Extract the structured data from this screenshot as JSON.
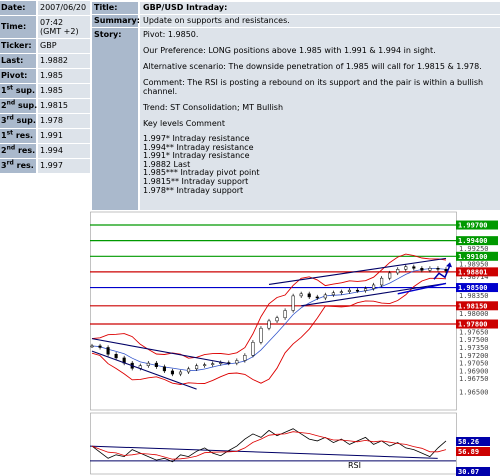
{
  "info": {
    "rows": [
      {
        "label": "Date:",
        "value": "2007/06/20"
      },
      {
        "label": "Time:",
        "value": "07:42",
        "value2": "(GMT +2)"
      },
      {
        "label": "Ticker:",
        "value": "GBP"
      },
      {
        "label": "Last:",
        "value": "1.9882"
      },
      {
        "label": "Pivot:",
        "value": "1.985"
      },
      {
        "label_num": "1",
        "label_sup": "st",
        "label_rest": " sup.",
        "value": "1.985"
      },
      {
        "label_num": "2",
        "label_sup": "nd",
        "label_rest": " sup.",
        "value": "1.9815"
      },
      {
        "label_num": "3",
        "label_sup": "rd",
        "label_rest": " sup.",
        "value": "1.978"
      },
      {
        "label_num": "1",
        "label_sup": "st",
        "label_rest": " res.",
        "value": "1.991"
      },
      {
        "label_num": "2",
        "label_sup": "nd",
        "label_rest": " res.",
        "value": "1.994"
      },
      {
        "label_num": "3",
        "label_sup": "rd",
        "label_rest": " res.",
        "value": "1.997"
      }
    ]
  },
  "story": {
    "title_label": "Title:",
    "title": "GBP/USD Intraday:",
    "summary_label": "Summary:",
    "summary": "Update on supports and resistances.",
    "story_label": "Story:",
    "pivot_line": "Pivot: 1.9850.",
    "preference": "Our Preference: LONG positions above 1.985 with 1.991 & 1.994 in sight.",
    "alternative": "Alternative scenario: The downside penetration of 1.985 will call for 1.9815 & 1.978.",
    "comment": "Comment: The RSI is posting a rebound on its support and the pair is within a bullish channel.",
    "trend": "Trend: ST Consolidation; MT Bullish",
    "key_levels_header": "Key levels Comment",
    "key_levels": [
      "1.997* Intraday resistance",
      "1.994** Intraday resistance",
      "1.991* Intraday resistance",
      "1.9882 Last",
      "1.985*** Intraday pivot point",
      "1.9815** Intraday support",
      "1.978** Intraday support"
    ]
  },
  "chart_data": {
    "type": "line",
    "ylim": [
      1.9615,
      1.9995
    ],
    "price_axis_ticks": [
      "1.99700",
      "1.99400",
      "1.99250",
      "1.99100",
      "1.98950",
      "1.98801",
      "1.98714",
      "1.98500",
      "1.98350",
      "1.98150",
      "1.98000",
      "1.97800",
      "1.97650",
      "1.97500",
      "1.97350",
      "1.97200",
      "1.97050",
      "1.96900",
      "1.96750",
      "1.96500"
    ],
    "highlighted_levels": [
      {
        "price": 1.997,
        "label": "1.99700",
        "color": "#009900"
      },
      {
        "price": 1.994,
        "label": "1.99400",
        "color": "#009900"
      },
      {
        "price": 1.991,
        "label": "1.99100",
        "color": "#009900"
      },
      {
        "price": 1.98801,
        "label": "1.98801",
        "color": "#cc0000"
      },
      {
        "price": 1.985,
        "label": "1.98500",
        "color": "#0000cc"
      },
      {
        "price": 1.9815,
        "label": "1.98150",
        "color": "#cc0000"
      },
      {
        "price": 1.978,
        "label": "1.97800",
        "color": "#cc0000"
      }
    ],
    "price_series": [
      1.9738,
      1.9735,
      1.9722,
      1.9715,
      1.9705,
      1.9695,
      1.97,
      1.9705,
      1.9698,
      1.969,
      1.9684,
      1.9688,
      1.9694,
      1.97,
      1.9702,
      1.9704,
      1.9706,
      1.9705,
      1.971,
      1.972,
      1.9745,
      1.9772,
      1.9786,
      1.9792,
      1.9806,
      1.9834,
      1.9838,
      1.9832,
      1.983,
      1.9836,
      1.984,
      1.9842,
      1.9845,
      1.9844,
      1.9848,
      1.9855,
      1.9868,
      1.9878,
      1.9885,
      1.989,
      1.9887,
      1.9883,
      1.9887,
      1.9885,
      1.9882
    ],
    "rsi": {
      "label": "RSI",
      "current_values": [
        "58.26",
        "56.89"
      ],
      "bottom_value": "30.07",
      "series": [
        52,
        45,
        38,
        42,
        40,
        48,
        44,
        40,
        36,
        38,
        34,
        42,
        40,
        46,
        50,
        44,
        41,
        47,
        52,
        60,
        66,
        62,
        70,
        64,
        68,
        72,
        66,
        60,
        58,
        62,
        56,
        60,
        54,
        58,
        62,
        54,
        58,
        52,
        56,
        50,
        48,
        44,
        40,
        50,
        58
      ]
    }
  }
}
